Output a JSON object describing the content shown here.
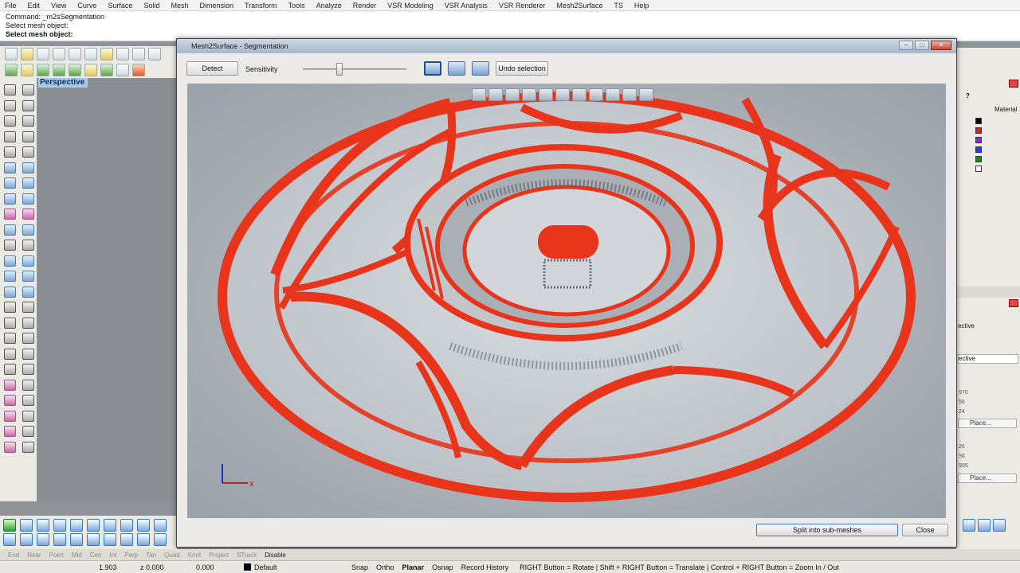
{
  "app": {
    "menu": [
      "File",
      "Edit",
      "View",
      "Curve",
      "Surface",
      "Solid",
      "Mesh",
      "Dimension",
      "Transform",
      "Tools",
      "Analyze",
      "Render",
      "VSR Modeling",
      "VSR Analysis",
      "VSR Renderer",
      "Mesh2Surface",
      "TS",
      "Help"
    ],
    "command_lines": [
      "Command: _m2sSegmentation",
      "Select mesh object:"
    ],
    "command_prompt": "Select mesh object:",
    "viewport_label": "Perspective"
  },
  "dialog": {
    "title": "Mesh2Surface - Segmentation",
    "detect_label": "Detect",
    "sensitivity_label": "Sensitivity",
    "sensitivity_level": 0.35,
    "undo_label": "Undo selection",
    "split_label": "Split into sub-meshes",
    "close_label": "Close",
    "axis_x": "x",
    "colors": {
      "highlight": "#e8341a",
      "surface": "#c9ced3"
    }
  },
  "right_panel": {
    "header": "Material",
    "help": "?",
    "layer_colors": [
      "#000000",
      "#e02020",
      "#8a2be2",
      "#1e3cff",
      "#1a8a1a",
      "#ffffff"
    ],
    "labels": [
      "ective",
      "ective"
    ],
    "numbers": [
      "970",
      "56",
      "24",
      "26",
      "56",
      "995"
    ],
    "place_label": "Place..."
  },
  "osnap": [
    "End",
    "Near",
    "Point",
    "Mid",
    "Cen",
    "Int",
    "Perp",
    "Tan",
    "Quad",
    "Knot",
    "Project",
    "STrack",
    "Disable"
  ],
  "status": {
    "x": "1.903",
    "y": "z 0.000",
    "z": "0.000",
    "layer": "Default",
    "toggles": [
      "Snap",
      "Ortho",
      "Planar",
      "Osnap",
      "Record History"
    ],
    "hint": "RIGHT Button = Rotate | Shift + RIGHT Button = Translate | Control + RIGHT Button = Zoom In / Out"
  }
}
